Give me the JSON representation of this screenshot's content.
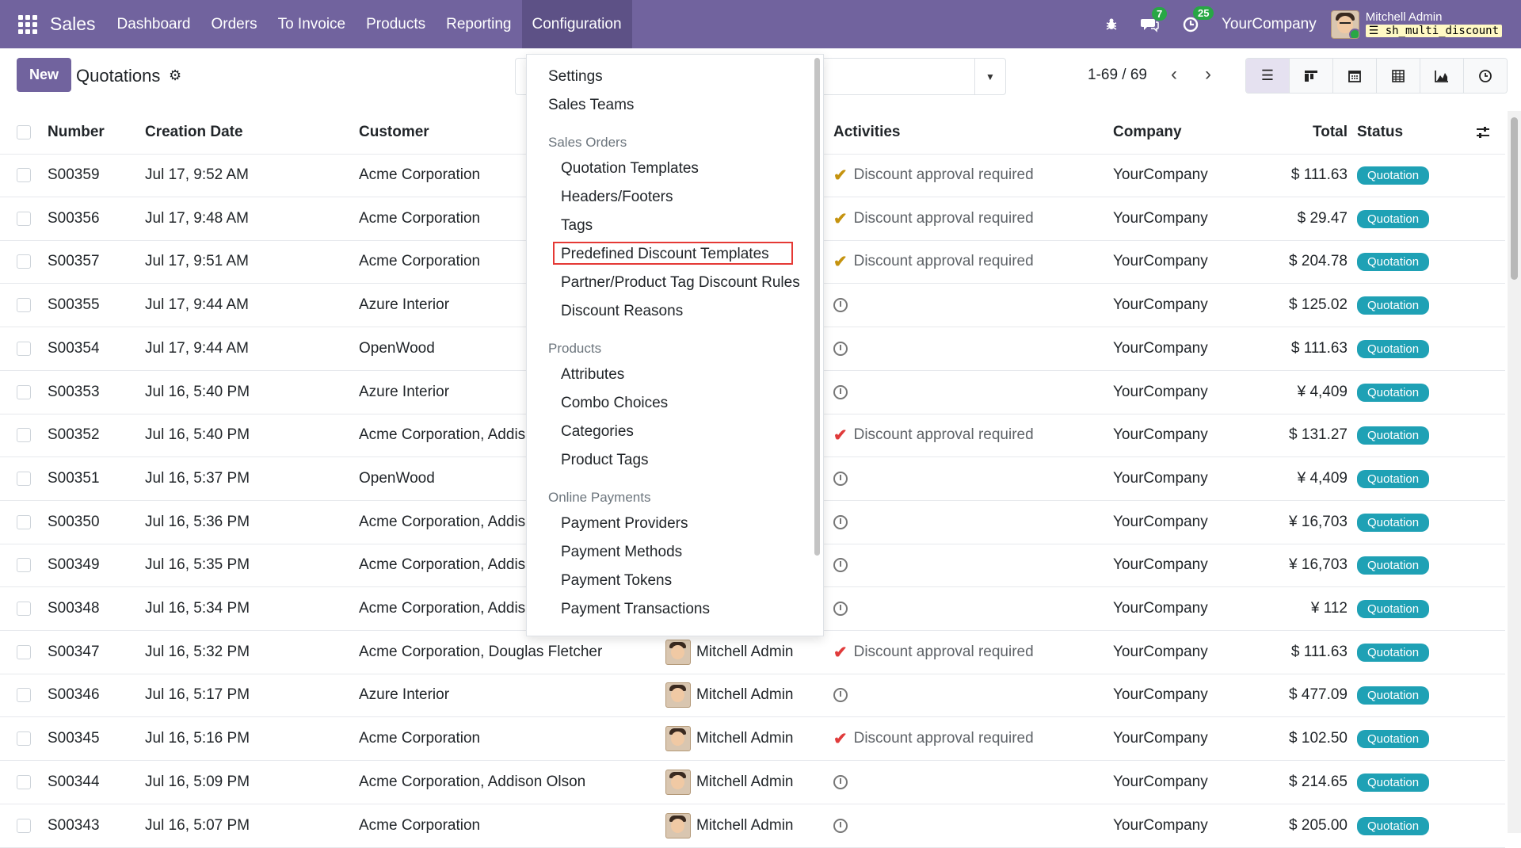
{
  "navbar": {
    "brand": "Sales",
    "menu": [
      "Dashboard",
      "Orders",
      "To Invoice",
      "Products",
      "Reporting",
      "Configuration"
    ],
    "messages_count": "7",
    "activities_count": "25",
    "company": "YourCompany",
    "user_name": "Mitchell Admin",
    "database": "sh_multi_discount"
  },
  "control": {
    "new_label": "New",
    "title": "Quotations",
    "pager": "1-69 / 69"
  },
  "columns": {
    "number": "Number",
    "date": "Creation Date",
    "customer": "Customer",
    "activities": "Activities",
    "company": "Company",
    "total": "Total",
    "status": "Status"
  },
  "rows": [
    {
      "number": "S00359",
      "date": "Jul 17, 9:52 AM",
      "customer": "Acme Corporation",
      "salesperson": "",
      "activity": "check-gold",
      "activity_text": "Discount approval required",
      "company": "YourCompany",
      "total": "$ 111.63",
      "status": "Quotation"
    },
    {
      "number": "S00356",
      "date": "Jul 17, 9:48 AM",
      "customer": "Acme Corporation",
      "salesperson": "",
      "activity": "check-gold",
      "activity_text": "Discount approval required",
      "company": "YourCompany",
      "total": "$ 29.47",
      "status": "Quotation"
    },
    {
      "number": "S00357",
      "date": "Jul 17, 9:51 AM",
      "customer": "Acme Corporation",
      "salesperson": "",
      "activity": "check-gold",
      "activity_text": "Discount approval required",
      "company": "YourCompany",
      "total": "$ 204.78",
      "status": "Quotation"
    },
    {
      "number": "S00355",
      "date": "Jul 17, 9:44 AM",
      "customer": "Azure Interior",
      "salesperson": "",
      "activity": "clock",
      "activity_text": "",
      "company": "YourCompany",
      "total": "$ 125.02",
      "status": "Quotation"
    },
    {
      "number": "S00354",
      "date": "Jul 17, 9:44 AM",
      "customer": "OpenWood",
      "salesperson": "",
      "activity": "clock",
      "activity_text": "",
      "company": "YourCompany",
      "total": "$ 111.63",
      "status": "Quotation"
    },
    {
      "number": "S00353",
      "date": "Jul 16, 5:40 PM",
      "customer": "Azure Interior",
      "salesperson": "",
      "activity": "clock",
      "activity_text": "",
      "company": "YourCompany",
      "total": "¥ 4,409",
      "status": "Quotation"
    },
    {
      "number": "S00352",
      "date": "Jul 16, 5:40 PM",
      "customer": "Acme Corporation, Addis",
      "salesperson": "",
      "activity": "check-red",
      "activity_text": "Discount approval required",
      "company": "YourCompany",
      "total": "$ 131.27",
      "status": "Quotation"
    },
    {
      "number": "S00351",
      "date": "Jul 16, 5:37 PM",
      "customer": "OpenWood",
      "salesperson": "",
      "activity": "clock",
      "activity_text": "",
      "company": "YourCompany",
      "total": "¥ 4,409",
      "status": "Quotation"
    },
    {
      "number": "S00350",
      "date": "Jul 16, 5:36 PM",
      "customer": "Acme Corporation, Addis",
      "salesperson": "",
      "activity": "clock",
      "activity_text": "",
      "company": "YourCompany",
      "total": "¥ 16,703",
      "status": "Quotation"
    },
    {
      "number": "S00349",
      "date": "Jul 16, 5:35 PM",
      "customer": "Acme Corporation, Addis",
      "salesperson": "",
      "activity": "clock",
      "activity_text": "",
      "company": "YourCompany",
      "total": "¥ 16,703",
      "status": "Quotation"
    },
    {
      "number": "S00348",
      "date": "Jul 16, 5:34 PM",
      "customer": "Acme Corporation, Addis",
      "salesperson": "",
      "activity": "clock",
      "activity_text": "",
      "company": "YourCompany",
      "total": "¥ 112",
      "status": "Quotation"
    },
    {
      "number": "S00347",
      "date": "Jul 16, 5:32 PM",
      "customer": "Acme Corporation, Douglas Fletcher",
      "salesperson": "Mitchell Admin",
      "activity": "check-red",
      "activity_text": "Discount approval required",
      "company": "YourCompany",
      "total": "$ 111.63",
      "status": "Quotation"
    },
    {
      "number": "S00346",
      "date": "Jul 16, 5:17 PM",
      "customer": "Azure Interior",
      "salesperson": "Mitchell Admin",
      "activity": "clock",
      "activity_text": "",
      "company": "YourCompany",
      "total": "$ 477.09",
      "status": "Quotation"
    },
    {
      "number": "S00345",
      "date": "Jul 16, 5:16 PM",
      "customer": "Acme Corporation",
      "salesperson": "Mitchell Admin",
      "activity": "check-red",
      "activity_text": "Discount approval required",
      "company": "YourCompany",
      "total": "$ 102.50",
      "status": "Quotation"
    },
    {
      "number": "S00344",
      "date": "Jul 16, 5:09 PM",
      "customer": "Acme Corporation, Addison Olson",
      "salesperson": "Mitchell Admin",
      "activity": "clock",
      "activity_text": "",
      "company": "YourCompany",
      "total": "$ 214.65",
      "status": "Quotation"
    },
    {
      "number": "S00343",
      "date": "Jul 16, 5:07 PM",
      "customer": "Acme Corporation",
      "salesperson": "Mitchell Admin",
      "activity": "clock",
      "activity_text": "",
      "company": "YourCompany",
      "total": "$ 205.00",
      "status": "Quotation"
    }
  ],
  "dropdown": {
    "settings": "Settings",
    "sales_teams": "Sales Teams",
    "section_sales_orders": "Sales Orders",
    "quotation_templates": "Quotation Templates",
    "headers_footers": "Headers/Footers",
    "tags": "Tags",
    "predefined_discount_templates": "Predefined Discount Templates",
    "partner_product_tag_discount_rules": "Partner/Product Tag Discount Rules",
    "discount_reasons": "Discount Reasons",
    "section_products": "Products",
    "attributes": "Attributes",
    "combo_choices": "Combo Choices",
    "categories": "Categories",
    "product_tags": "Product Tags",
    "section_online_payments": "Online Payments",
    "payment_providers": "Payment Providers",
    "payment_methods": "Payment Methods",
    "payment_tokens": "Payment Tokens",
    "payment_transactions": "Payment Transactions"
  },
  "colors": {
    "navbar": "#71639e",
    "status_badge": "#1fa1b5",
    "highlight": "#e53935"
  }
}
